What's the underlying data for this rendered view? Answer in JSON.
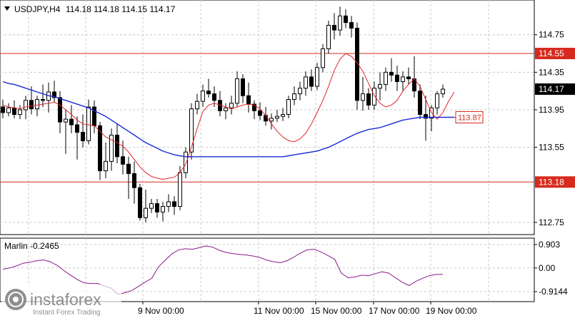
{
  "header": {
    "symbol": "USDJPY,H4",
    "ohlc": "114.18 114.18 114.15 114.17"
  },
  "colors": {
    "grid": "#c8c8c8",
    "level_line": "#d62a1e",
    "fast_ma": "#e0262c",
    "slow_ma": "#1a2bd6",
    "oscillator": "#8b1a8b",
    "candle": "#000000"
  },
  "chart_data": [
    {
      "type": "candlestick",
      "x_ticks": [
        "9 Nov 00:00",
        "11 Nov 00:00",
        "15 Nov 00:00",
        "17 Nov 00:00",
        "19 Nov 00:00"
      ],
      "y_ticks": [
        114.75,
        114.35,
        113.95,
        113.55,
        112.75
      ],
      "ylim": [
        112.62,
        115.12
      ],
      "current_price": 114.17,
      "levels": [
        {
          "value": 114.55,
          "label": "114.55"
        },
        {
          "value": 113.18,
          "label": "113.18"
        }
      ],
      "ma_label": "113.87",
      "candles": [
        [
          113.98,
          114.06,
          113.86,
          113.92
        ],
        [
          113.92,
          114.02,
          113.88,
          113.97
        ],
        [
          113.97,
          114.05,
          113.86,
          113.9
        ],
        [
          113.9,
          114.0,
          113.85,
          113.95
        ],
        [
          113.95,
          114.1,
          113.85,
          114.05
        ],
        [
          114.05,
          114.2,
          113.9,
          113.96
        ],
        [
          113.96,
          114.1,
          113.88,
          114.06
        ],
        [
          114.06,
          114.22,
          113.98,
          114.05
        ],
        [
          114.05,
          114.24,
          113.92,
          114.14
        ],
        [
          114.14,
          114.26,
          114.03,
          114.08
        ],
        [
          114.08,
          114.15,
          113.7,
          113.82
        ],
        [
          113.82,
          113.95,
          113.48,
          113.85
        ],
        [
          113.85,
          114.0,
          113.7,
          113.79
        ],
        [
          113.79,
          113.88,
          113.42,
          113.71
        ],
        [
          113.71,
          113.9,
          113.55,
          113.62
        ],
        [
          113.62,
          114.06,
          113.58,
          113.98
        ],
        [
          113.98,
          114.05,
          113.7,
          113.78
        ],
        [
          113.78,
          113.82,
          113.2,
          113.3
        ],
        [
          113.3,
          113.6,
          113.22,
          113.4
        ],
        [
          113.4,
          113.75,
          113.3,
          113.68
        ],
        [
          113.68,
          113.8,
          113.38,
          113.45
        ],
        [
          113.45,
          113.62,
          113.26,
          113.37
        ],
        [
          113.37,
          113.45,
          113.0,
          113.27
        ],
        [
          113.27,
          113.4,
          112.95,
          113.12
        ],
        [
          113.12,
          113.16,
          112.77,
          112.8
        ],
        [
          112.8,
          113.1,
          112.75,
          112.9
        ],
        [
          112.9,
          113.0,
          112.85,
          112.95
        ],
        [
          112.95,
          113.0,
          112.8,
          112.86
        ],
        [
          112.86,
          112.97,
          112.76,
          112.92
        ],
        [
          112.92,
          113.05,
          112.86,
          112.97
        ],
        [
          112.97,
          113.03,
          112.83,
          112.92
        ],
        [
          112.92,
          113.35,
          112.88,
          113.28
        ],
        [
          113.28,
          113.55,
          113.22,
          113.5
        ],
        [
          113.5,
          114.02,
          113.42,
          113.96
        ],
        [
          113.96,
          114.12,
          113.9,
          114.04
        ],
        [
          114.04,
          114.22,
          113.98,
          114.15
        ],
        [
          114.15,
          114.28,
          114.08,
          114.12
        ],
        [
          114.12,
          114.2,
          113.98,
          114.05
        ],
        [
          114.05,
          114.15,
          113.88,
          113.94
        ],
        [
          113.94,
          114.02,
          113.85,
          113.97
        ],
        [
          113.97,
          114.1,
          113.9,
          114.02
        ],
        [
          114.02,
          114.36,
          113.98,
          114.28
        ],
        [
          114.28,
          114.33,
          114.02,
          114.1
        ],
        [
          114.1,
          114.24,
          113.92,
          114.01
        ],
        [
          114.01,
          114.05,
          113.85,
          113.94
        ],
        [
          113.94,
          114.03,
          113.84,
          113.89
        ],
        [
          113.89,
          113.98,
          113.78,
          113.83
        ],
        [
          113.83,
          113.91,
          113.74,
          113.86
        ],
        [
          113.86,
          113.95,
          113.82,
          113.88
        ],
        [
          113.88,
          113.97,
          113.83,
          113.9
        ],
        [
          113.9,
          114.1,
          113.86,
          114.06
        ],
        [
          114.06,
          114.2,
          114.0,
          114.12
        ],
        [
          114.12,
          114.25,
          114.05,
          114.18
        ],
        [
          114.18,
          114.36,
          114.1,
          114.3
        ],
        [
          114.3,
          114.38,
          114.15,
          114.2
        ],
        [
          114.2,
          114.45,
          114.16,
          114.4
        ],
        [
          114.4,
          114.65,
          114.35,
          114.6
        ],
        [
          114.6,
          114.9,
          114.55,
          114.85
        ],
        [
          114.85,
          114.98,
          114.7,
          114.8
        ],
        [
          114.8,
          115.05,
          114.74,
          114.95
        ],
        [
          114.95,
          115.02,
          114.82,
          114.88
        ],
        [
          114.88,
          114.95,
          114.72,
          114.82
        ],
        [
          114.82,
          114.88,
          113.95,
          114.05
        ],
        [
          114.05,
          114.3,
          113.94,
          114.12
        ],
        [
          114.12,
          114.18,
          113.95,
          114.0
        ],
        [
          114.0,
          114.25,
          113.95,
          114.18
        ],
        [
          114.18,
          114.35,
          114.05,
          114.22
        ],
        [
          114.22,
          114.4,
          114.15,
          114.35
        ],
        [
          114.35,
          114.5,
          114.25,
          114.32
        ],
        [
          114.32,
          114.42,
          114.15,
          114.25
        ],
        [
          114.25,
          114.36,
          114.15,
          114.3
        ],
        [
          114.3,
          114.4,
          114.22,
          114.28
        ],
        [
          114.28,
          114.52,
          114.08,
          114.15
        ],
        [
          114.15,
          114.22,
          113.85,
          113.9
        ],
        [
          113.9,
          114.1,
          113.62,
          113.86
        ],
        [
          113.86,
          114.0,
          113.72,
          113.97
        ],
        [
          113.97,
          114.15,
          113.9,
          114.12
        ],
        [
          114.12,
          114.22,
          114.08,
          114.17
        ]
      ],
      "fast_ma": [
        114.0,
        113.98,
        113.97,
        113.96,
        113.98,
        113.99,
        114.0,
        114.01,
        114.02,
        114.03,
        114.0,
        113.95,
        113.9,
        113.84,
        113.8,
        113.79,
        113.78,
        113.72,
        113.66,
        113.63,
        113.6,
        113.56,
        113.5,
        113.42,
        113.34,
        113.28,
        113.24,
        113.22,
        113.21,
        113.22,
        113.23,
        113.28,
        113.37,
        113.55,
        113.75,
        113.93,
        114.0,
        114.02,
        114.0,
        113.98,
        113.96,
        113.98,
        114.0,
        114.01,
        114.0,
        113.96,
        113.89,
        113.8,
        113.72,
        113.66,
        113.62,
        113.61,
        113.64,
        113.7,
        113.8,
        113.92,
        114.05,
        114.2,
        114.37,
        114.49,
        114.55,
        114.52,
        114.45,
        114.36,
        114.23,
        114.1,
        114.02,
        113.98,
        114.0,
        114.05,
        114.15,
        114.22,
        114.28,
        114.2,
        114.06,
        113.92,
        113.85,
        113.92,
        114.04,
        114.14
      ],
      "slow_ma": [
        114.25,
        114.23,
        114.22,
        114.2,
        114.18,
        114.16,
        114.14,
        114.12,
        114.1,
        114.09,
        114.07,
        114.05,
        114.03,
        114.01,
        113.99,
        113.97,
        113.94,
        113.91,
        113.88,
        113.84,
        113.8,
        113.76,
        113.72,
        113.68,
        113.64,
        113.6,
        113.57,
        113.54,
        113.51,
        113.49,
        113.47,
        113.46,
        113.45,
        113.45,
        113.45,
        113.45,
        113.45,
        113.45,
        113.45,
        113.45,
        113.45,
        113.45,
        113.45,
        113.45,
        113.45,
        113.45,
        113.45,
        113.45,
        113.45,
        113.45,
        113.46,
        113.47,
        113.48,
        113.49,
        113.5,
        113.51,
        113.53,
        113.55,
        113.58,
        113.61,
        113.64,
        113.67,
        113.7,
        113.72,
        113.74,
        113.75,
        113.76,
        113.78,
        113.8,
        113.82,
        113.84,
        113.85,
        113.86,
        113.87,
        113.87,
        113.87,
        113.87,
        113.87,
        113.87,
        113.87
      ]
    },
    {
      "type": "line",
      "name": "Marlin -0.2465",
      "y_ticks": [
        "0.903",
        "0.00",
        "-0.9144"
      ],
      "ylim": [
        -1.3,
        1.15
      ],
      "values": [
        -0.05,
        0.0,
        0.08,
        0.18,
        0.22,
        0.28,
        0.31,
        0.24,
        0.1,
        -0.1,
        -0.28,
        -0.45,
        -0.58,
        -0.6,
        -0.6,
        -0.7,
        -0.78,
        -1.02,
        -0.96,
        -0.88,
        -0.72,
        -0.55,
        -0.4,
        0.05,
        0.3,
        0.55,
        0.7,
        0.74,
        0.72,
        0.78,
        0.85,
        0.8,
        0.68,
        0.6,
        0.55,
        0.52,
        0.5,
        0.46,
        0.4,
        0.3,
        0.24,
        0.2,
        0.28,
        0.42,
        0.58,
        0.7,
        0.72,
        0.62,
        0.48,
        0.34,
        -0.2,
        -0.38,
        -0.35,
        -0.28,
        -0.3,
        -0.22,
        -0.15,
        -0.2,
        -0.38,
        -0.55,
        -0.68,
        -0.52,
        -0.4,
        -0.3,
        -0.25,
        -0.25
      ]
    }
  ]
}
